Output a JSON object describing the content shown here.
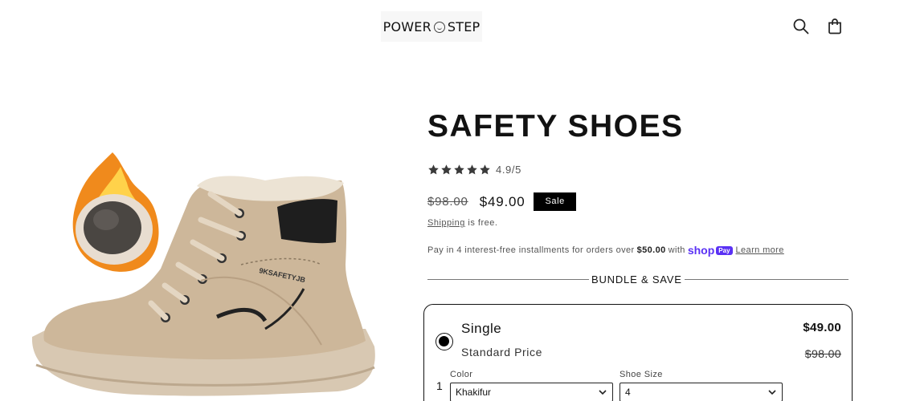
{
  "header": {
    "logo_left": "POWER",
    "logo_right": "STEP",
    "icons": [
      "search-icon",
      "cart-icon"
    ]
  },
  "product": {
    "title": "SAFETY SHOES",
    "rating_text": "4.9/5",
    "rating_value": 4.9,
    "rating_max": 5,
    "price_compare": "$98.00",
    "price_sale": "$49.00",
    "sale_badge": "Sale",
    "shipping_link": "Shipping",
    "shipping_rest": " is free.",
    "installments_prefix": "Pay in 4 interest-free installments for orders over",
    "installments_amount": "$50.00",
    "installments_with": "with",
    "shoppay_label": "shop",
    "shoppay_pay": "Pay",
    "learn_more": "Learn more",
    "image_alt": "safety shoes"
  },
  "bundle": {
    "heading": "BUNDLE & SAVE",
    "option": {
      "title": "Single",
      "subtitle": "Standard Price",
      "price": "$49.00",
      "compare_price": "$98.00",
      "selected": true,
      "row_number": "1",
      "color_label": "Color",
      "color_value": "Khakifur",
      "size_label": "Shoe Size",
      "size_value": "4"
    }
  },
  "colors": {
    "shoppay": "#5a31f4",
    "text": "#121212",
    "boot_leather": "#cdb79a",
    "sole": "#d8c8b2"
  }
}
